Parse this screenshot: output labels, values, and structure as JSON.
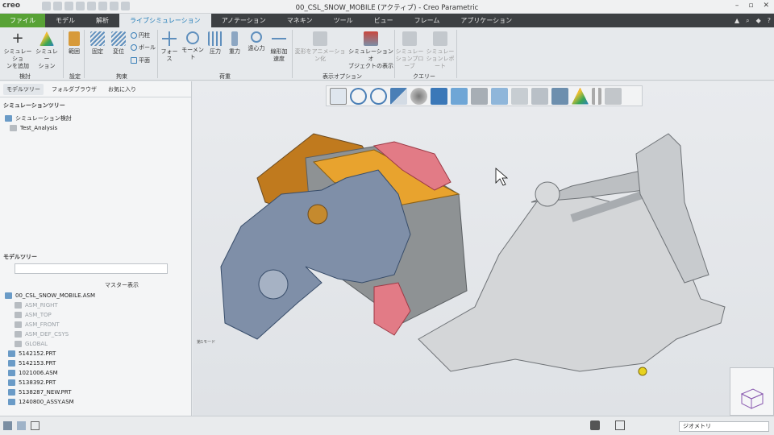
{
  "app": {
    "logo": "creo",
    "title": "00_CSL_SNOW_MOBILE (アクティブ) - Creo Parametric",
    "window_controls": [
      "–",
      "▫",
      "✕"
    ]
  },
  "tabs": [
    {
      "label": "ファイル"
    },
    {
      "label": "モデル"
    },
    {
      "label": "解析"
    },
    {
      "label": "ライブシミュレーション"
    },
    {
      "label": "アノテーション"
    },
    {
      "label": "マネキン"
    },
    {
      "label": "ツール"
    },
    {
      "label": "ビュー"
    },
    {
      "label": "フレーム"
    },
    {
      "label": "アプリケーション"
    }
  ],
  "ribbon": {
    "add_sim_1": "シミュレーショ",
    "add_sim_2": "ンを追加",
    "sim_1": "シミュレー",
    "sim_2": "ション",
    "range": "範囲",
    "fixed": "固定",
    "displacement": "変位",
    "cylinder": "円柱",
    "ball": "ボール",
    "plane": "平面",
    "force": "フォース",
    "moment": "モーメント",
    "pressure": "圧力",
    "gravity": "重力",
    "centrifugal": "遠心力",
    "lin_accel_1": "線形加",
    "lin_accel_2": "速度",
    "anim_deform": "変形をアニメーション化",
    "sim_obj_1": "シミュレーションオ",
    "sim_obj_2": "ブジェクトの表示",
    "probe_1": "シミュレー",
    "probe_2": "ションプローブ",
    "report_1": "シミュレー",
    "report_2": "ションレポート",
    "groups": {
      "study": "検討",
      "setup": "設定",
      "constraint": "拘束",
      "load": "荷重",
      "display": "表示オプション",
      "query": "クエリー"
    }
  },
  "left": {
    "tab_model_tree": "モデルツリー",
    "tab_folder": "フォルダブラウザ",
    "tab_favorites": "お気に入り",
    "sim_tree_title": "シミュレーションツリー",
    "sim_tree": [
      "シミュレーション検討",
      "Test_Analysis"
    ],
    "model_tree_title": "モデルツリー",
    "master_display": "マスター表示",
    "model_tree": [
      {
        "label": "00_CSL_SNOW_MOBILE.ASM",
        "dim": false
      },
      {
        "label": "ASM_RIGHT",
        "dim": true
      },
      {
        "label": "ASM_TOP",
        "dim": true
      },
      {
        "label": "ASM_FRONT",
        "dim": true
      },
      {
        "label": "ASM_DEF_CSYS",
        "dim": true
      },
      {
        "label": "GLOBAL",
        "dim": true
      },
      {
        "label": "5142152.PRT",
        "dim": false
      },
      {
        "label": "5142153.PRT",
        "dim": false
      },
      {
        "label": "1021006.ASM",
        "dim": false
      },
      {
        "label": "5138392.PRT",
        "dim": false
      },
      {
        "label": "5138287_NEW.PRT",
        "dim": false
      },
      {
        "label": "1240800_ASSY.ASM",
        "dim": false
      }
    ]
  },
  "viewport": {
    "view_toolbar_icons": [
      "refit-icon",
      "zoom-in-icon",
      "zoom-out-icon",
      "repaint-icon",
      "display-style-icon",
      "named-views-icon",
      "saved-orientations-icon",
      "view-manager-icon",
      "perspective-icon",
      "datum-display-icon",
      "spin-center-icon",
      "annotation-display-icon",
      "simulation-display-icon",
      "pause-icon",
      "reset-icon"
    ],
    "mode_label": "第1モード"
  },
  "status": {
    "filter_value": "ジオメトリ"
  },
  "colors": {
    "file_tab": "#58a236",
    "tab_bar": "#3d4043",
    "orange_part": "#e8a32e",
    "pink_part": "#e27b86",
    "blue_part": "#7f8fa8"
  }
}
